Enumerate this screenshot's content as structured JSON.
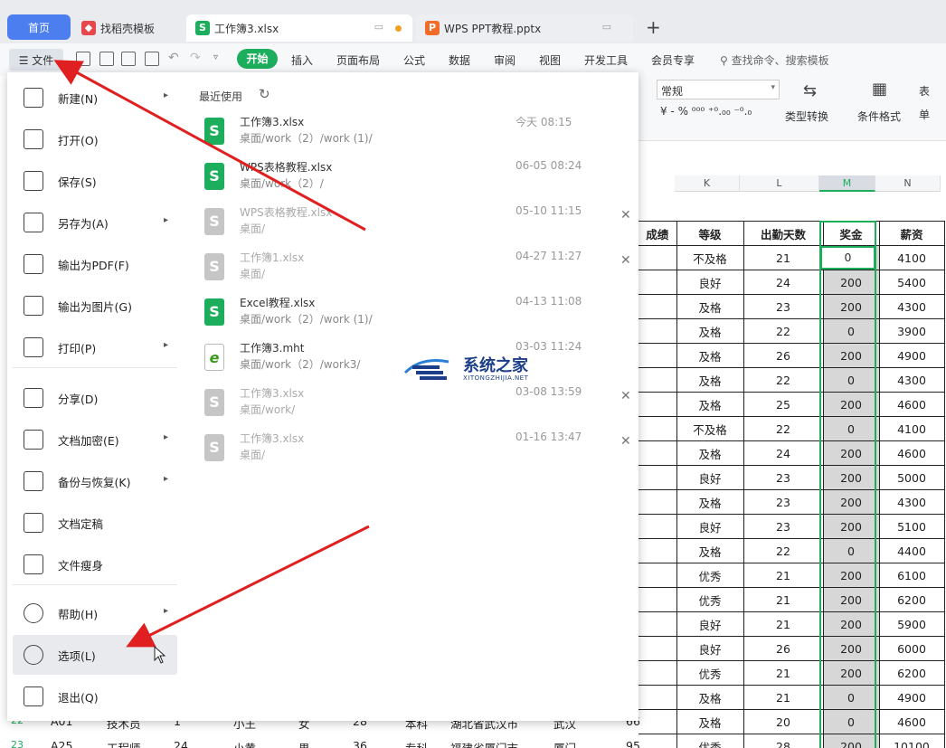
{
  "tabs": {
    "home": "首页",
    "daoke": "找稻壳模板",
    "active": "工作簿3.xlsx",
    "ppt": "WPS PPT教程.pptx",
    "add": "+",
    "icon_s": "S",
    "icon_p": "P"
  },
  "ribbon": {
    "file": "☰ 文件",
    "menus": [
      "开始",
      "插入",
      "页面布局",
      "公式",
      "数据",
      "审阅",
      "视图",
      "开发工具",
      "会员专享"
    ],
    "search": "查找命令、搜索模板"
  },
  "format_panel": {
    "number_format": "常规",
    "symbols": "¥ ‐  %  ⁰⁰⁰  ⁺⁰.₀₀  ⁻⁰.₀",
    "type_convert": "类型转换",
    "cond_format": "条件格式",
    "table_partial": "表",
    "single_partial": "单"
  },
  "columns": [
    "K",
    "L",
    "M",
    "N"
  ],
  "grid": {
    "headers": [
      "成绩",
      "等级",
      "出勤天数",
      "奖金",
      "薪资"
    ],
    "rows": [
      [
        "不及格",
        "21",
        "0",
        "4100"
      ],
      [
        "良好",
        "24",
        "200",
        "5400"
      ],
      [
        "及格",
        "23",
        "200",
        "4300"
      ],
      [
        "及格",
        "22",
        "0",
        "3900"
      ],
      [
        "及格",
        "26",
        "200",
        "4900"
      ],
      [
        "及格",
        "22",
        "0",
        "4300"
      ],
      [
        "及格",
        "25",
        "200",
        "4600"
      ],
      [
        "不及格",
        "22",
        "0",
        "4100"
      ],
      [
        "及格",
        "24",
        "200",
        "4600"
      ],
      [
        "良好",
        "23",
        "200",
        "5000"
      ],
      [
        "及格",
        "23",
        "200",
        "4300"
      ],
      [
        "良好",
        "23",
        "200",
        "5100"
      ],
      [
        "及格",
        "22",
        "0",
        "4400"
      ],
      [
        "优秀",
        "21",
        "200",
        "6100"
      ],
      [
        "优秀",
        "21",
        "200",
        "6200"
      ],
      [
        "良好",
        "21",
        "200",
        "5900"
      ],
      [
        "良好",
        "26",
        "200",
        "6000"
      ],
      [
        "优秀",
        "21",
        "200",
        "6200"
      ],
      [
        "及格",
        "21",
        "0",
        "4900"
      ],
      [
        "及格",
        "20",
        "0",
        "4600"
      ],
      [
        "优秀",
        "28",
        "200",
        "10100"
      ]
    ],
    "bottom_row_1": [
      "22",
      "A01",
      "技术员",
      "1",
      "小王",
      "女",
      "28",
      "本科",
      "湖北省武汉市",
      "武汉",
      "66"
    ],
    "bottom_row_2": [
      "23",
      "A25",
      "工程师",
      "24",
      "小黄",
      "男",
      "36",
      "专科",
      "福建省厦门市",
      "厦门",
      "95"
    ]
  },
  "file_menu": {
    "items": [
      {
        "label": "新建(N)",
        "icon": "new-icon",
        "arrow": true
      },
      {
        "label": "打开(O)",
        "icon": "folder-icon",
        "arrow": false
      },
      {
        "label": "保存(S)",
        "icon": "save-icon",
        "arrow": false
      },
      {
        "label": "另存为(A)",
        "icon": "save-as-icon",
        "arrow": true
      },
      {
        "label": "输出为PDF(F)",
        "icon": "pdf-icon",
        "arrow": false
      },
      {
        "label": "输出为图片(G)",
        "icon": "image-icon",
        "arrow": false
      },
      {
        "label": "打印(P)",
        "icon": "print-icon",
        "arrow": true
      },
      {
        "label": "分享(D)",
        "icon": "share-icon",
        "arrow": false
      },
      {
        "label": "文档加密(E)",
        "icon": "encrypt-icon",
        "arrow": true
      },
      {
        "label": "备份与恢复(K)",
        "icon": "backup-icon",
        "arrow": true
      },
      {
        "label": "文档定稿",
        "icon": "finalize-icon",
        "arrow": false
      },
      {
        "label": "文件瘦身",
        "icon": "slim-icon",
        "arrow": false
      },
      {
        "label": "帮助(H)",
        "icon": "help-icon",
        "arrow": true
      },
      {
        "label": "选项(L)",
        "icon": "gear-icon",
        "arrow": false
      },
      {
        "label": "退出(Q)",
        "icon": "exit-icon",
        "arrow": false
      }
    ],
    "recent_title": "最近使用",
    "recent": [
      {
        "name": "工作簿3.xlsx",
        "path": "桌面/work（2）/work (1)/",
        "date": "今天  08:15",
        "icon": "S",
        "style": "green",
        "closable": false,
        "dim": false
      },
      {
        "name": "WPS表格教程.xlsx",
        "path": "桌面/work（2）/",
        "date": "06-05  08:24",
        "icon": "S",
        "style": "green",
        "closable": false,
        "dim": false
      },
      {
        "name": "WPS表格教程.xlsx",
        "path": "桌面/",
        "date": "05-10  11:15",
        "icon": "S",
        "style": "grey",
        "closable": true,
        "dim": true
      },
      {
        "name": "工作簿1.xlsx",
        "path": "桌面/",
        "date": "04-27  11:27",
        "icon": "S",
        "style": "grey",
        "closable": true,
        "dim": true
      },
      {
        "name": "Excel教程.xlsx",
        "path": "桌面/work（2）/work (1)/",
        "date": "04-13  11:08",
        "icon": "S",
        "style": "green",
        "closable": false,
        "dim": false
      },
      {
        "name": "工作簿3.mht",
        "path": "桌面/work（2）/work3/",
        "date": "03-03  11:24",
        "icon": "e",
        "style": "ie",
        "closable": false,
        "dim": false
      },
      {
        "name": "工作簿3.xlsx",
        "path": "桌面/work/",
        "date": "03-08  13:59",
        "icon": "S",
        "style": "grey",
        "closable": true,
        "dim": true
      },
      {
        "name": "工作簿3.xlsx",
        "path": "桌面/",
        "date": "01-16  13:47",
        "icon": "S",
        "style": "grey",
        "closable": true,
        "dim": true
      }
    ]
  },
  "watermark": {
    "title": "系统之家",
    "subtitle": "XITONGZHIJIA.NET"
  },
  "colors": {
    "accent": "#1dae5d",
    "home_tab": "#4c7ef0",
    "arrow": "#e02020"
  }
}
